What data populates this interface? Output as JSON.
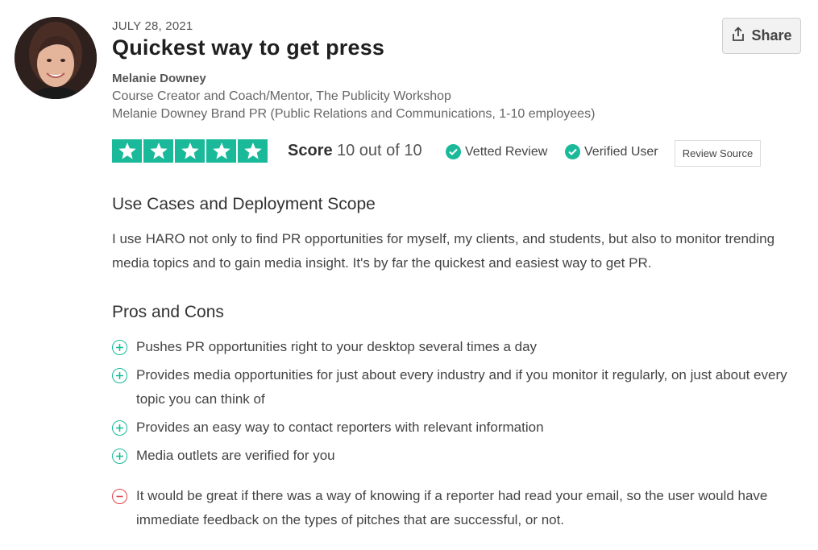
{
  "review": {
    "date": "JULY 28, 2021",
    "title": "Quickest way to get press",
    "share_label": "Share"
  },
  "author": {
    "name": "Melanie Downey",
    "role": "Course Creator and Coach/Mentor, The Publicity Workshop",
    "company": "Melanie Downey Brand PR (Public Relations and Communications, 1-10 employees)"
  },
  "rating": {
    "stars": 5,
    "max_stars": 5,
    "score_label": "Score",
    "score_value": "10 out of 10",
    "vetted_label": "Vetted Review",
    "verified_label": "Verified User",
    "review_source_label": "Review Source"
  },
  "use_cases": {
    "heading": "Use Cases and Deployment Scope",
    "text": "I use HARO not only to find PR opportunities for myself, my clients, and students, but also to monitor trending media topics and to gain media insight. It's by far the quickest and easiest way to get PR."
  },
  "pros_cons": {
    "heading": "Pros and Cons",
    "pros": [
      "Pushes PR opportunities right to your desktop several times a day",
      "Provides media opportunities for just about every industry and if you monitor it regularly, on just about every topic you can think of",
      "Provides an easy way to contact reporters with relevant information",
      "Media outlets are verified for you"
    ],
    "cons": [
      "It would be great if there was a way of knowing if a reporter had read your email, so the user would have immediate feedback on the types of pitches that are successful, or not."
    ]
  },
  "colors": {
    "accent": "#1ab99a",
    "con": "#e0454c"
  },
  "icons": {
    "share": "share-upload-icon",
    "star": "star-icon",
    "check": "check-circle-icon",
    "plus": "plus-circle-icon",
    "minus": "minus-circle-icon"
  }
}
